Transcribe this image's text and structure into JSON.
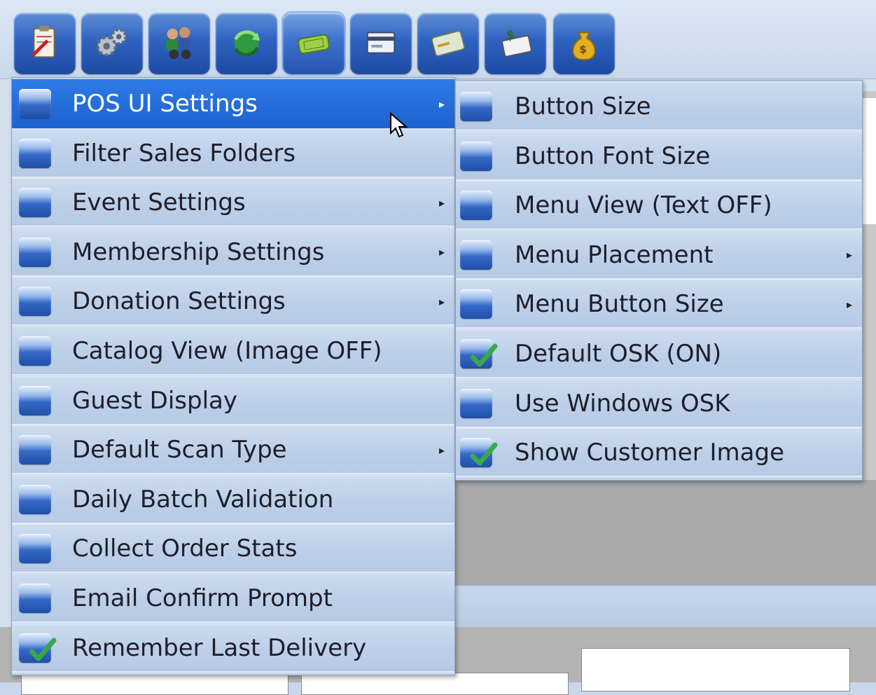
{
  "toolbar": {
    "buttons": [
      {
        "name": "clipboard-edit-icon"
      },
      {
        "name": "gears-icon"
      },
      {
        "name": "people-binoculars-icon"
      },
      {
        "name": "refresh-globe-icon"
      },
      {
        "name": "ticket-icon"
      },
      {
        "name": "credit-card-terminal-icon"
      },
      {
        "name": "credit-card-icon"
      },
      {
        "name": "cash-card-icon"
      },
      {
        "name": "money-bag-icon"
      }
    ]
  },
  "main_menu": {
    "items": [
      {
        "label": "POS UI Settings",
        "submenu": true,
        "highlighted": true
      },
      {
        "label": "Filter Sales Folders",
        "submenu": false
      },
      {
        "label": "Event Settings",
        "submenu": true
      },
      {
        "label": "Membership Settings",
        "submenu": true
      },
      {
        "label": "Donation Settings",
        "submenu": true
      },
      {
        "label": "Catalog View (Image OFF)",
        "submenu": false
      },
      {
        "label": "Guest Display",
        "submenu": false
      },
      {
        "label": "Default Scan Type",
        "submenu": true
      },
      {
        "label": "Daily Batch Validation",
        "submenu": false
      },
      {
        "label": "Collect Order Stats",
        "submenu": false
      },
      {
        "label": "Email Confirm Prompt",
        "submenu": false
      },
      {
        "label": "Remember Last Delivery",
        "submenu": false,
        "checked": true
      }
    ]
  },
  "sub_menu": {
    "items": [
      {
        "label": "Button Size",
        "submenu": false
      },
      {
        "label": "Button Font Size",
        "submenu": false
      },
      {
        "label": "Menu View (Text OFF)",
        "submenu": false
      },
      {
        "label": "Menu Placement",
        "submenu": true
      },
      {
        "label": "Menu Button Size",
        "submenu": true
      },
      {
        "label": "Default OSK (ON)",
        "submenu": false,
        "checked": true
      },
      {
        "label": "Use Windows OSK",
        "submenu": false
      },
      {
        "label": "Show Customer Image",
        "submenu": false,
        "checked": true
      }
    ]
  },
  "arrow_glyph": "▸",
  "colors": {
    "highlight": "#1c62d0",
    "menu_bg": "#c4d4ea",
    "check": "#3aa84a"
  }
}
